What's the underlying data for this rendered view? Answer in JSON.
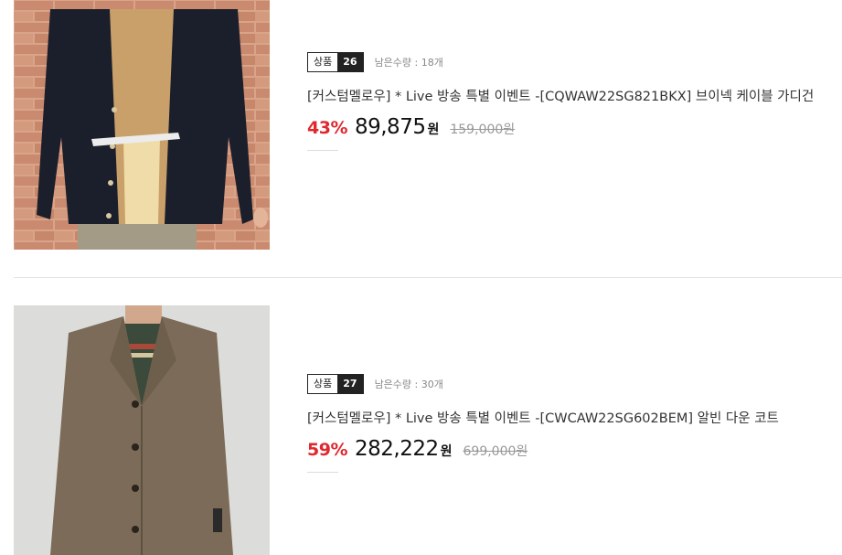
{
  "products": [
    {
      "badge_label": "상품",
      "badge_number": "26",
      "remaining": "남은수량 : 18개",
      "title": "[커스텀멜로우] * Live 방송 특별 이벤트 -[CQWAW22SG821BKX] 브이넥 케이블 가디건",
      "discount": "43%",
      "price": "89,875",
      "currency": "원",
      "original_price": "159,000원",
      "image_icon": "cardigan-photo"
    },
    {
      "badge_label": "상품",
      "badge_number": "27",
      "remaining": "남은수량 : 30개",
      "title": "[커스텀멜로우] * Live 방송 특별 이벤트 -[CWCAW22SG602BEM] 알빈 다운 코트",
      "discount": "59%",
      "price": "282,222",
      "currency": "원",
      "original_price": "699,000원",
      "image_icon": "coat-photo"
    }
  ],
  "colors": {
    "discount": "#e0282e",
    "badge_dark": "#222222",
    "divider": "#e5e5e5"
  }
}
